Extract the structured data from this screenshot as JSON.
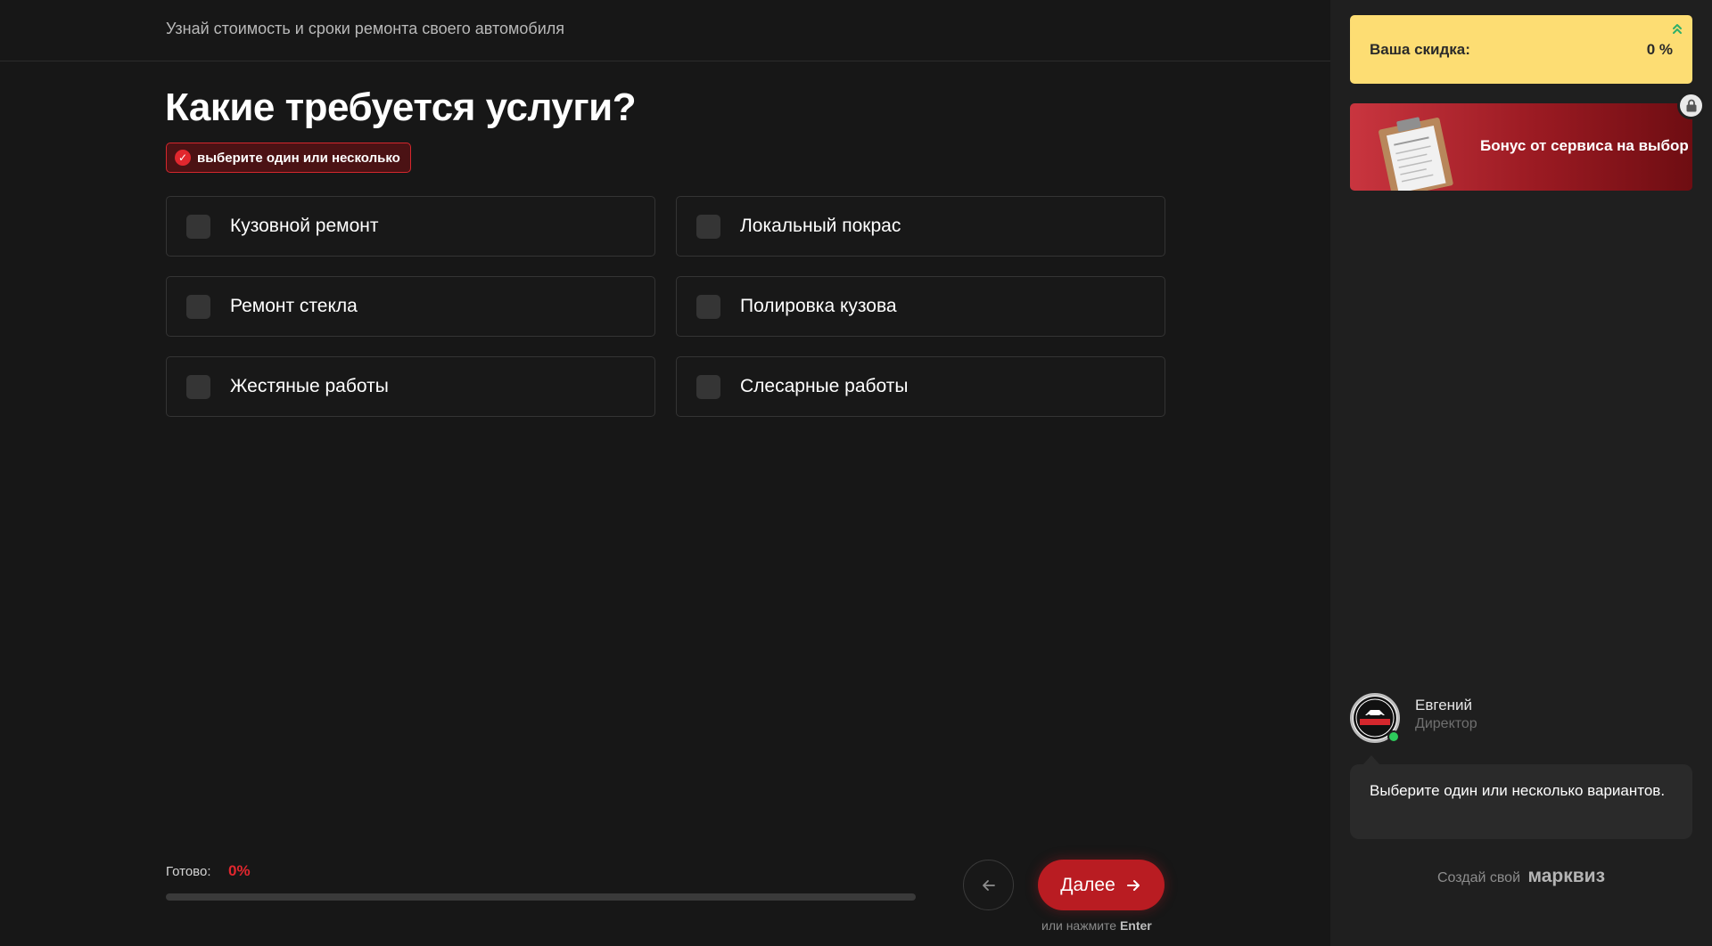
{
  "header": {
    "subtitle": "Узнай стоимость и сроки ремонта своего автомобиля"
  },
  "question": {
    "title": "Какие требуется услуги?",
    "hint": "выберите один или несколько"
  },
  "options": [
    {
      "label": "Кузовной ремонт",
      "checked": false
    },
    {
      "label": "Локальный покрас",
      "checked": false
    },
    {
      "label": "Ремонт стекла",
      "checked": false
    },
    {
      "label": "Полировка кузова",
      "checked": false
    },
    {
      "label": "Жестяные работы",
      "checked": false
    },
    {
      "label": "Слесарные работы",
      "checked": false
    }
  ],
  "progress": {
    "label": "Готово:",
    "value_text": "0%",
    "percent": 0
  },
  "navigation": {
    "back_icon": "arrow-left-icon",
    "next_label": "Далее",
    "next_icon": "arrow-right-icon",
    "enter_hint_prefix": "или нажмите",
    "enter_hint_key": "Enter"
  },
  "sidebar": {
    "discount": {
      "label": "Ваша скидка:",
      "value": "0 %"
    },
    "bonus": {
      "label": "Бонус от сервиса на выбор",
      "locked": true
    },
    "manager": {
      "name": "Евгений",
      "role": "Директор",
      "online": true
    },
    "message": "Выберите один или несколько вариантов.",
    "brand": {
      "prefix": "Создай свой",
      "name": "марквиз"
    }
  },
  "colors": {
    "accent": "#e1272e",
    "discount_bg": "#fddd73",
    "background": "#171717",
    "sidebar_bg": "#1f1f1f"
  }
}
